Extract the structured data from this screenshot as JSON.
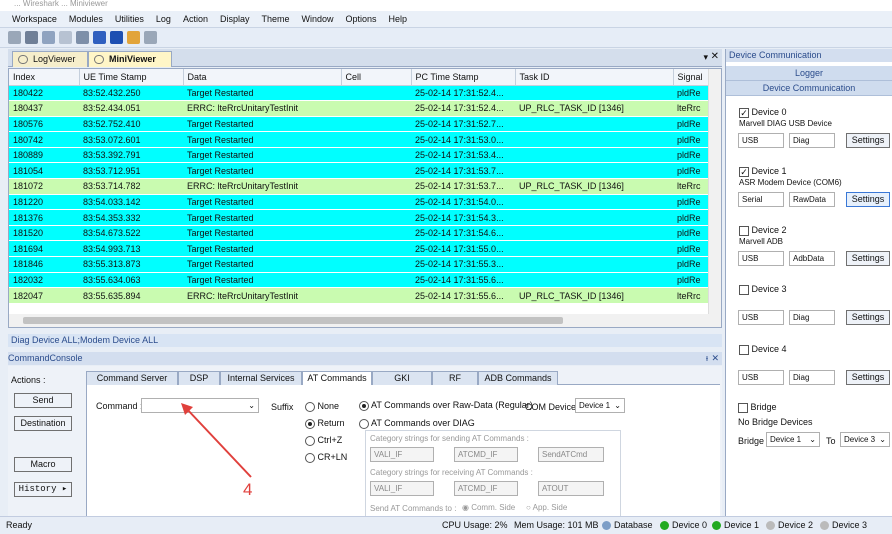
{
  "window": {
    "title": "... Wireshark ... Miniviewer"
  },
  "menu": [
    "Workspace",
    "Modules",
    "Utilities",
    "Log",
    "Action",
    "Display",
    "Theme",
    "Window",
    "Options",
    "Help"
  ],
  "tabs": [
    {
      "label": "LogViewer"
    },
    {
      "label": "MiniViewer"
    }
  ],
  "grid": {
    "columns": [
      "Index",
      "UE Time Stamp",
      "Data",
      "Cell",
      "PC Time Stamp",
      "Task ID",
      "Signal"
    ],
    "rows": [
      {
        "index": "180422",
        "ue": "83:52.432.250",
        "data": "Target Restarted",
        "cell": "",
        "pc": "25-02-14 17:31:52.4...",
        "task": "",
        "signal": "pldRe",
        "color": "cyan"
      },
      {
        "index": "180437",
        "ue": "83:52.434.051",
        "data": "ERRC: lteRrcUnitaryTestInit",
        "cell": "",
        "pc": "25-02-14 17:31:52.4...",
        "task": "UP_RLC_TASK_ID [1346]",
        "signal": "lteRrc",
        "color": "green"
      },
      {
        "index": "180576",
        "ue": "83:52.752.410",
        "data": "Target Restarted",
        "cell": "",
        "pc": "25-02-14 17:31:52.7...",
        "task": "",
        "signal": "pldRe",
        "color": "cyan"
      },
      {
        "index": "180742",
        "ue": "83:53.072.601",
        "data": "Target Restarted",
        "cell": "",
        "pc": "25-02-14 17:31:53.0...",
        "task": "",
        "signal": "pldRe",
        "color": "cyan"
      },
      {
        "index": "180889",
        "ue": "83:53.392.791",
        "data": "Target Restarted",
        "cell": "",
        "pc": "25-02-14 17:31:53.4...",
        "task": "",
        "signal": "pldRe",
        "color": "cyan"
      },
      {
        "index": "181054",
        "ue": "83:53.712.951",
        "data": "Target Restarted",
        "cell": "",
        "pc": "25-02-14 17:31:53.7...",
        "task": "",
        "signal": "pldRe",
        "color": "cyan"
      },
      {
        "index": "181072",
        "ue": "83:53.714.782",
        "data": "ERRC: lteRrcUnitaryTestInit",
        "cell": "",
        "pc": "25-02-14 17:31:53.7...",
        "task": "UP_RLC_TASK_ID [1346]",
        "signal": "lteRrc",
        "color": "green"
      },
      {
        "index": "181220",
        "ue": "83:54.033.142",
        "data": "Target Restarted",
        "cell": "",
        "pc": "25-02-14 17:31:54.0...",
        "task": "",
        "signal": "pldRe",
        "color": "cyan"
      },
      {
        "index": "181376",
        "ue": "83:54.353.332",
        "data": "Target Restarted",
        "cell": "",
        "pc": "25-02-14 17:31:54.3...",
        "task": "",
        "signal": "pldRe",
        "color": "cyan"
      },
      {
        "index": "181520",
        "ue": "83:54.673.522",
        "data": "Target Restarted",
        "cell": "",
        "pc": "25-02-14 17:31:54.6...",
        "task": "",
        "signal": "pldRe",
        "color": "cyan"
      },
      {
        "index": "181694",
        "ue": "83:54.993.713",
        "data": "Target Restarted",
        "cell": "",
        "pc": "25-02-14 17:31:55.0...",
        "task": "",
        "signal": "pldRe",
        "color": "cyan"
      },
      {
        "index": "181846",
        "ue": "83:55.313.873",
        "data": "Target Restarted",
        "cell": "",
        "pc": "25-02-14 17:31:55.3...",
        "task": "",
        "signal": "pldRe",
        "color": "cyan"
      },
      {
        "index": "182032",
        "ue": "83:55.634.063",
        "data": "Target Restarted",
        "cell": "",
        "pc": "25-02-14 17:31:55.6...",
        "task": "",
        "signal": "pldRe",
        "color": "cyan"
      },
      {
        "index": "182047",
        "ue": "83:55.635.894",
        "data": "ERRC: lteRrcUnitaryTestInit",
        "cell": "",
        "pc": "25-02-14 17:31:55.6...",
        "task": "UP_RLC_TASK_ID [1346]",
        "signal": "lteRrc",
        "color": "green"
      }
    ]
  },
  "statusline": "Diag Device ALL;Modem Device ALL",
  "console": {
    "title": "CommandConsole",
    "actions_label": "Actions :",
    "send": "Send",
    "destination": "Destination",
    "macro": "Macro",
    "history": "History",
    "subtabs": [
      "Command Server",
      "DSP",
      "Internal Services",
      "AT Commands",
      "GKI",
      "RF",
      "ADB Commands"
    ],
    "command_label": "Command :",
    "suffix_label": "Suffix",
    "suffix_options": [
      "None",
      "Return",
      "Ctrl+Z",
      "CR+LN"
    ],
    "mode_rawdata": "AT Commands over Raw-Data (Regular)",
    "mode_diag": "AT Commands over DIAG",
    "com_device_label": "COM Device:",
    "com_device_value": "Device 1",
    "cat_send_label": "Category strings for sending AT Commands :",
    "cat_send": [
      "VALI_IF",
      "ATCMD_IF",
      "SendATCmd"
    ],
    "cat_recv_label": "Category strings for receiving AT Commands :",
    "cat_recv": [
      "VALI_IF",
      "ATCMD_IF",
      "ATOUT"
    ],
    "send_to_label": "Send AT Commands to :",
    "comm_side": "Comm. Side",
    "app_side": "App. Side",
    "annotation": "4"
  },
  "right": {
    "header": "Device Communication",
    "logger": "Logger",
    "devcomm": "Device Communication",
    "devices": [
      {
        "name": "Device 0",
        "checked": true,
        "desc": "Marvell DIAG USB Device",
        "f1": "USB",
        "f2": "Diag",
        "btn": "Settings"
      },
      {
        "name": "Device 1",
        "checked": true,
        "desc": "ASR Modem Device (COM6)",
        "f1": "Serial",
        "f2": "RawData",
        "btn": "Settings"
      },
      {
        "name": "Device 2",
        "checked": false,
        "desc": "Marvell ADB",
        "f1": "USB",
        "f2": "AdbData",
        "btn": "Settings"
      },
      {
        "name": "Device 3",
        "checked": false,
        "desc": "",
        "f1": "USB",
        "f2": "Diag",
        "btn": "Settings"
      },
      {
        "name": "Device 4",
        "checked": false,
        "desc": "",
        "f1": "USB",
        "f2": "Diag",
        "btn": "Settings"
      }
    ],
    "bridge": "Bridge",
    "no_bridge": "No Bridge Devices",
    "bridge_label": "Bridge",
    "bridge_from": "Device 1",
    "to_label": "To",
    "bridge_to": "Device 3"
  },
  "status": {
    "ready": "Ready",
    "cpu": "CPU Usage:  2%",
    "mem": "Mem Usage: 101 MB",
    "database": "Database",
    "dev0": "Device 0",
    "dev1": "Device 1",
    "dev2": "Device 2",
    "dev3": "Device 3"
  },
  "colors": {
    "cyan_row": "#00ffff",
    "green_row": "#c9fbb0",
    "ok": "#22aa22",
    "arrow": "#e0403c"
  }
}
